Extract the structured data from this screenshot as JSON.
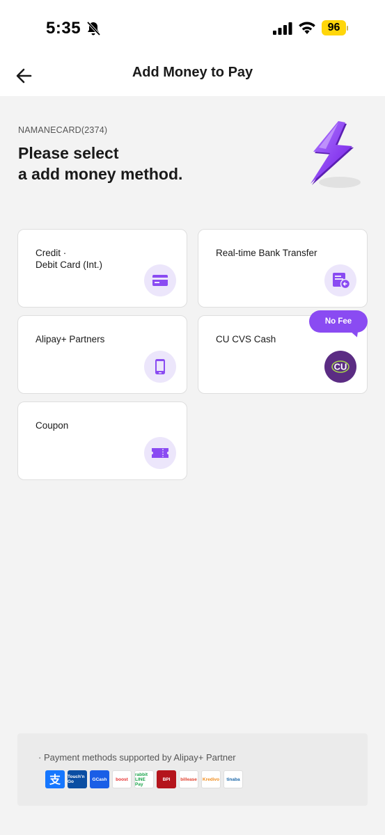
{
  "status_bar": {
    "time": "5:35",
    "battery": "96",
    "icons": [
      "bell-slash-icon",
      "signal-icon",
      "wifi-icon",
      "battery-icon"
    ]
  },
  "nav": {
    "title": "Add Money to Pay",
    "back_icon": "arrow-left-icon"
  },
  "header": {
    "account": "NAMANECARD(2374)",
    "heading_line1": "Please select",
    "heading_line2": "a add money method.",
    "illustration": "lightning-bolt-icon"
  },
  "methods": [
    {
      "line1": "Credit ·",
      "line2": "Debit Card (Int.)",
      "icon": "credit-card-icon"
    },
    {
      "line1": "Real-time Bank Transfer",
      "line2": "",
      "icon": "bank-transfer-icon"
    },
    {
      "line1": "Alipay+ Partners",
      "line2": "",
      "icon": "mobile-phone-icon"
    },
    {
      "line1": "CU CVS Cash",
      "line2": "",
      "icon": "cu-logo-icon",
      "badge": "No Fee"
    },
    {
      "line1": "Coupon",
      "line2": "",
      "icon": "ticket-icon"
    }
  ],
  "footer": {
    "note": "· Payment methods supported by Alipay+ Partner",
    "logos": [
      {
        "name": "alipay",
        "text": ""
      },
      {
        "name": "touch-n-go",
        "text": "Touch'n Go"
      },
      {
        "name": "gcash",
        "text": "GCash"
      },
      {
        "name": "boost",
        "text": "boost"
      },
      {
        "name": "rabbit-line-pay",
        "text": "rabbit LINE Pay"
      },
      {
        "name": "bpi",
        "text": "BPI"
      },
      {
        "name": "billease",
        "text": "billease"
      },
      {
        "name": "kredivo",
        "text": "Kredivo"
      },
      {
        "name": "tinaba",
        "text": "tinaba"
      }
    ]
  },
  "colors": {
    "accent": "#8a4bf2",
    "icon_bg": "#ece6fb",
    "cu_purple": "#5b2c83",
    "battery": "#ffd60a",
    "page_bg": "#f3f3f3"
  }
}
